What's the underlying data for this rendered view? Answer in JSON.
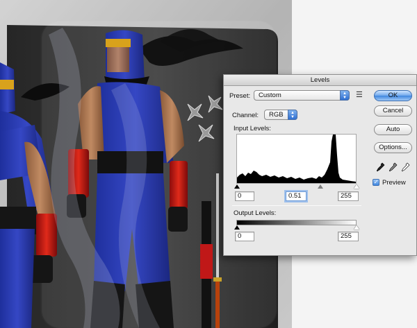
{
  "dialog": {
    "title": "Levels",
    "preset_label": "Preset:",
    "preset_value": "Custom",
    "channel_label": "Channel:",
    "channel_value": "RGB",
    "input_levels_label": "Input Levels:",
    "input_levels": {
      "black": "0",
      "gamma": "0.51",
      "white": "255"
    },
    "output_levels_label": "Output Levels:",
    "output_levels": {
      "black": "0",
      "white": "255"
    },
    "buttons": {
      "ok": "OK",
      "cancel": "Cancel",
      "auto": "Auto",
      "options": "Options..."
    },
    "preview_label": "Preview",
    "preview_checked": true,
    "accent_color": "#3f86df"
  },
  "icons": {
    "preset_menu": "list-icon",
    "black_eyedropper": "eyedropper-black-icon",
    "gray_eyedropper": "eyedropper-gray-icon",
    "white_eyedropper": "eyedropper-white-icon"
  }
}
